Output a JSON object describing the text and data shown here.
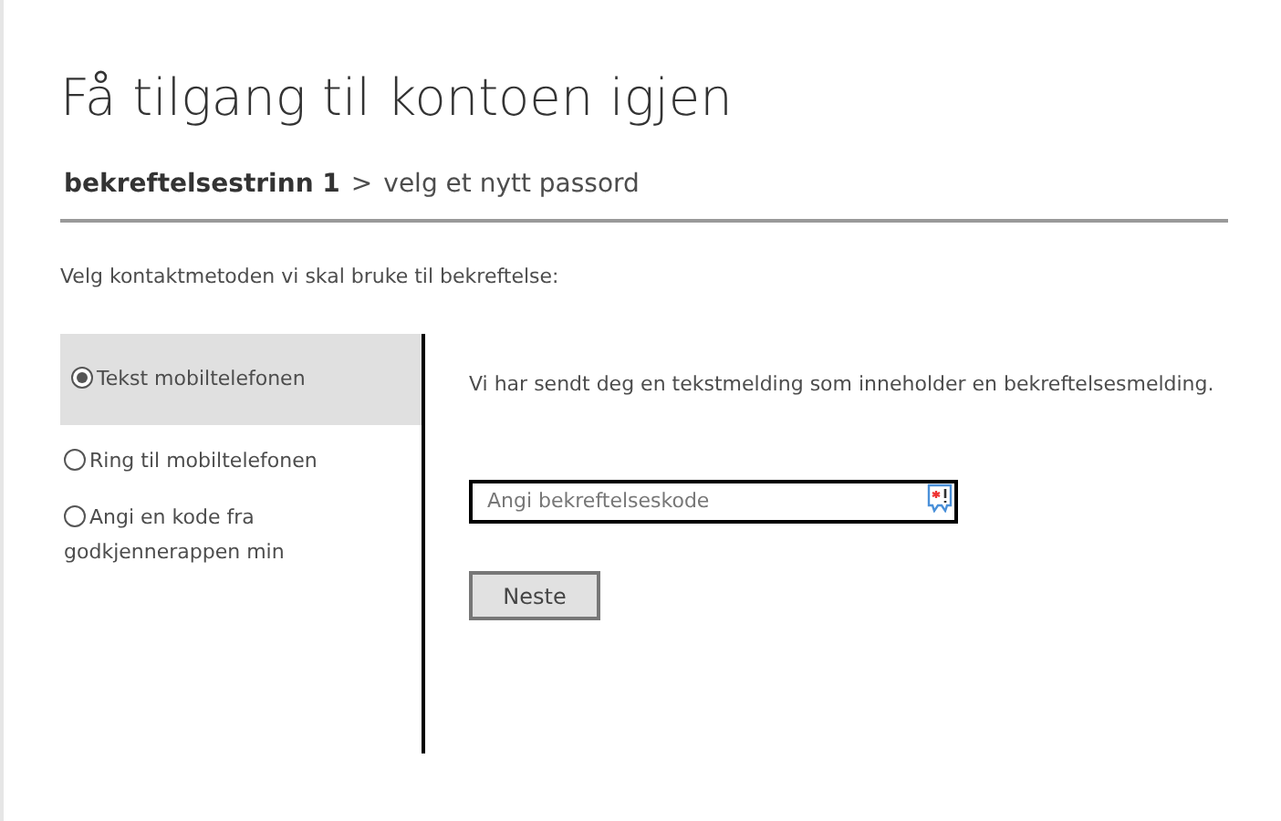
{
  "title": "Få tilgang til kontoen igjen",
  "breadcrumb": {
    "current_step": "bekreftelsestrinn 1",
    "separator": ">",
    "next_step": "velg et nytt passord"
  },
  "instruction": "Velg kontaktmetoden vi skal bruke til bekreftelse:",
  "methods": [
    {
      "label": "Tekst mobiltelefonen",
      "selected": true
    },
    {
      "label": "Ring til mobiltelefonen",
      "selected": false
    },
    {
      "label": "Angi en kode fra godkjennerappen min",
      "selected": false
    }
  ],
  "message": "Vi har sendt deg en tekstmelding som inneholder en bekreftelsesmelding.",
  "code_field": {
    "placeholder": "Angi bekreftelseskode"
  },
  "next_button": "Neste"
}
